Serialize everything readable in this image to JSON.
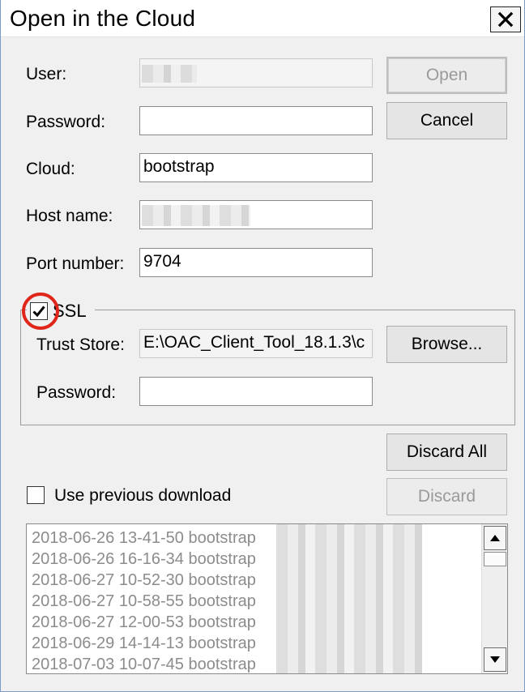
{
  "window": {
    "title": "Open in the Cloud"
  },
  "fields": {
    "user_label": "User:",
    "user_value": "",
    "password_label": "Password:",
    "password_value": "",
    "cloud_label": "Cloud:",
    "cloud_value": "bootstrap",
    "host_label": "Host name:",
    "host_value": "",
    "port_label": "Port number:",
    "port_value": "9704"
  },
  "buttons": {
    "open": "Open",
    "cancel": "Cancel",
    "browse": "Browse...",
    "discard_all": "Discard All",
    "discard": "Discard"
  },
  "ssl": {
    "label": "SSL",
    "checked": true,
    "trust_store_label": "Trust Store:",
    "trust_store_value": "E:\\OAC_Client_Tool_18.1.3\\c",
    "password_label": "Password:",
    "password_value": ""
  },
  "use_previous": {
    "label": "Use previous download",
    "checked": false
  },
  "downloads": [
    "2018-06-26 13-41-50 bootstrap",
    "2018-06-26 16-16-34 bootstrap",
    "2018-06-27 10-52-30 bootstrap",
    "2018-06-27 10-58-55 bootstrap",
    "2018-06-27 12-00-53 bootstrap",
    "2018-06-29 14-14-13 bootstrap",
    "2018-07-03 10-07-45 bootstrap"
  ],
  "colors": {
    "highlight": "#e0261a"
  },
  "icons": {
    "close": "close-icon",
    "check": "checkmark-icon",
    "scroll_up": "arrow-up-icon",
    "scroll_down": "arrow-down-icon"
  }
}
